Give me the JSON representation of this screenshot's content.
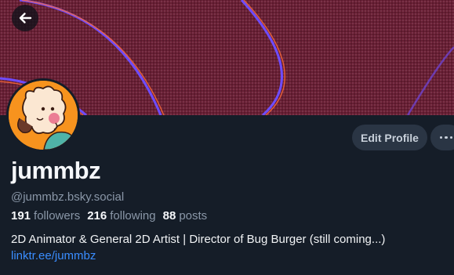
{
  "profile": {
    "display_name": "jummbz",
    "handle": "@jummbz.bsky.social",
    "stats": {
      "followers_count": "191",
      "followers_label": "followers",
      "following_count": "216",
      "following_label": "following",
      "posts_count": "88",
      "posts_label": "posts"
    },
    "bio": "2D Animator & General 2D Artist | Director of Bug Burger (still coming...)",
    "link": "linktr.ee/jummbz"
  },
  "actions": {
    "edit_profile_label": "Edit Profile"
  },
  "icons": {
    "back": "arrow-left-icon",
    "more": "ellipsis-icon"
  },
  "colors": {
    "background": "#151d28",
    "banner": "#6a1f35",
    "accent_link": "#3a8dff",
    "button_bg": "#2a3544",
    "avatar_bg": "#f7931e"
  }
}
